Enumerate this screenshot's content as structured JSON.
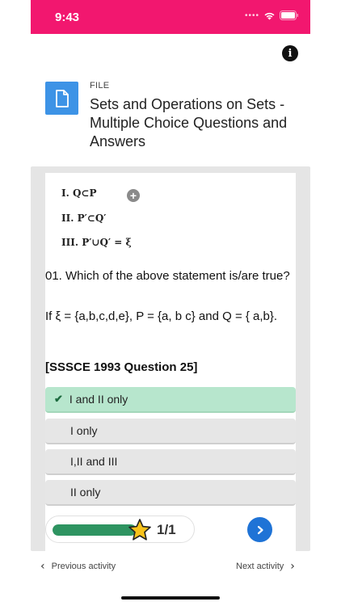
{
  "status": {
    "time": "9:43"
  },
  "header": {
    "file_label": "FILE",
    "title": "Sets and Operations on Sets - Multiple Choice Questions and Answers"
  },
  "question": {
    "statements": [
      "I. Q⊂P",
      "II. P′⊂Q′",
      "III. P′∪Q′ = ξ"
    ],
    "text": "01. Which of the above statement is/are true?",
    "given": "If ξ = {a,b,c,d,e}, P = {a, b c} and Q = { a,b}.",
    "source": "[SSSCE 1993 Question 25]"
  },
  "options": [
    {
      "label": "I and II only",
      "correct": true
    },
    {
      "label": "I only",
      "correct": false
    },
    {
      "label": "I,II and III",
      "correct": false
    },
    {
      "label": "II only",
      "correct": false
    }
  ],
  "progress": {
    "text": "1/1",
    "fraction": 1.0
  },
  "nav": {
    "previous": "Previous activity",
    "next": "Next activity"
  },
  "colors": {
    "status_bar": "#f2176f",
    "file_icon": "#3d93e6",
    "correct_option": "#b7e6cd",
    "progress_fill": "#2e9461",
    "next_button": "#1f73d6"
  },
  "icons": {
    "info": "info-icon",
    "file": "file-icon",
    "check": "check-icon",
    "star": "star-icon",
    "next": "chevron-right-icon"
  }
}
